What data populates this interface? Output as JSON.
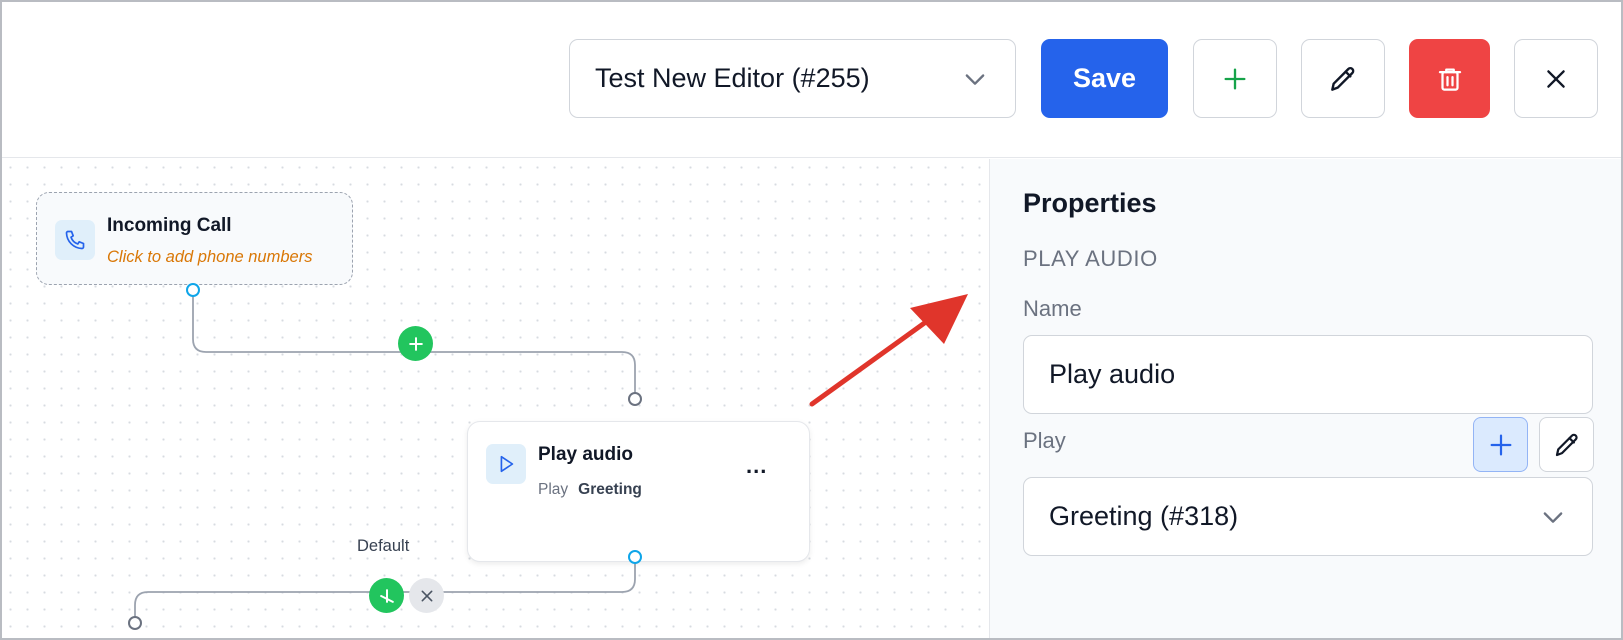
{
  "header": {
    "flow_name": "Test New Editor (#255)",
    "save_label": "Save"
  },
  "canvas": {
    "incoming": {
      "title": "Incoming Call",
      "hint": "Click to add phone numbers"
    },
    "play_node": {
      "title": "Play audio",
      "sub_key": "Play",
      "sub_value": "Greeting",
      "menu": "..."
    },
    "edge_label": "Default"
  },
  "panel": {
    "title": "Properties",
    "section": "PLAY AUDIO",
    "name_label": "Name",
    "name_value": "Play audio",
    "play_label": "Play",
    "play_value": "Greeting (#318)"
  },
  "colors": {
    "primary": "#2563eb",
    "danger": "#ef4444",
    "success": "#22c55e",
    "handle": "#0ea5e9",
    "hint": "#d97706",
    "annotation_arrow": "#e0352b"
  },
  "icons": {
    "flow_select": "chevron-down-icon",
    "add": "plus-icon",
    "edit": "pencil-icon",
    "delete": "trash-icon",
    "close": "close-icon",
    "incoming": "phone-icon",
    "play": "play-icon"
  }
}
